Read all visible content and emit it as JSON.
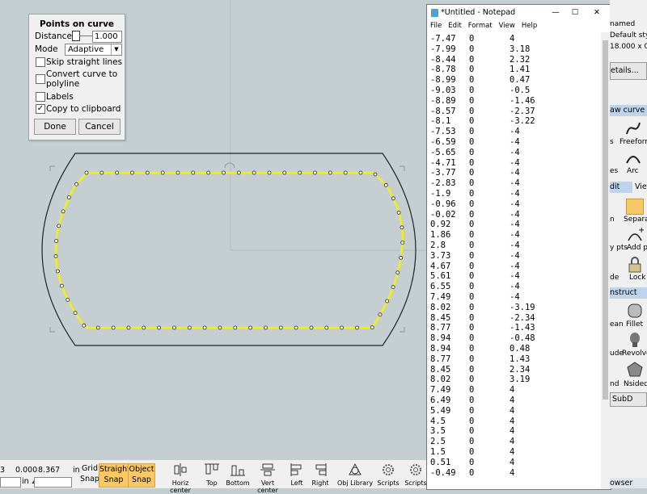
{
  "dialog": {
    "title": "Points on curve",
    "distance_label": "Distance",
    "distance_value": "1.000",
    "mode_label": "Mode",
    "mode_value": "Adaptive",
    "skip_label": "Skip straight lines",
    "convert_label_1": "Convert curve to",
    "convert_label_2": "polyline",
    "labels_label": "Labels",
    "copy_label": "Copy to clipboard",
    "done_label": "Done",
    "cancel_label": "Cancel",
    "skip_checked": false,
    "convert_checked": false,
    "labels_checked": false,
    "copy_checked": true
  },
  "notepad": {
    "title": "*Untitled - Notepad",
    "minimize": "—",
    "maximize": "☐",
    "close": "✕",
    "menu": [
      "File",
      "Edit",
      "Format",
      "View",
      "Help"
    ],
    "rows": [
      [
        "-7.47",
        "0",
        "4"
      ],
      [
        "-7.99",
        "0",
        "3.18"
      ],
      [
        "-8.44",
        "0",
        "2.32"
      ],
      [
        "-8.78",
        "0",
        "1.41"
      ],
      [
        "-8.99",
        "0",
        "0.47"
      ],
      [
        "-9.03",
        "0",
        "-0.5"
      ],
      [
        "-8.89",
        "0",
        "-1.46"
      ],
      [
        "-8.57",
        "0",
        "-2.37"
      ],
      [
        "-8.1",
        "0",
        "-3.22"
      ],
      [
        "-7.53",
        "0",
        "-4"
      ],
      [
        "-6.59",
        "0",
        "-4"
      ],
      [
        "-5.65",
        "0",
        "-4"
      ],
      [
        "-4.71",
        "0",
        "-4"
      ],
      [
        "-3.77",
        "0",
        "-4"
      ],
      [
        "-2.83",
        "0",
        "-4"
      ],
      [
        "-1.9",
        "0",
        "-4"
      ],
      [
        "-0.96",
        "0",
        "-4"
      ],
      [
        "-0.02",
        "0",
        "-4"
      ],
      [
        "0.92",
        "0",
        "-4"
      ],
      [
        "1.86",
        "0",
        "-4"
      ],
      [
        "2.8",
        "0",
        "-4"
      ],
      [
        "3.73",
        "0",
        "-4"
      ],
      [
        "4.67",
        "0",
        "-4"
      ],
      [
        "5.61",
        "0",
        "-4"
      ],
      [
        "6.55",
        "0",
        "-4"
      ],
      [
        "7.49",
        "0",
        "-4"
      ],
      [
        "8.02",
        "0",
        "-3.19"
      ],
      [
        "8.45",
        "0",
        "-2.34"
      ],
      [
        "8.77",
        "0",
        "-1.43"
      ],
      [
        "8.94",
        "0",
        "-0.48"
      ],
      [
        "8.94",
        "0",
        "0.48"
      ],
      [
        "8.77",
        "0",
        "1.43"
      ],
      [
        "8.45",
        "0",
        "2.34"
      ],
      [
        "8.02",
        "0",
        "3.19"
      ],
      [
        "7.49",
        "0",
        "4"
      ],
      [
        "6.49",
        "0",
        "4"
      ],
      [
        "5.49",
        "0",
        "4"
      ],
      [
        "4.5",
        "0",
        "4"
      ],
      [
        "3.5",
        "0",
        "4"
      ],
      [
        "2.5",
        "0",
        "4"
      ],
      [
        "1.5",
        "0",
        "4"
      ],
      [
        "0.51",
        "0",
        "4"
      ],
      [
        "-0.49",
        "0",
        "4"
      ]
    ]
  },
  "right_panel": {
    "doc_name": "named",
    "style": "Default sty",
    "size": "18.000 x 0",
    "details_button": "etails...",
    "draw_curve_tab": "aw curve",
    "freeform_label": "Freeform",
    "arc_label": "Arc",
    "s_label": "s",
    "es_label": "es",
    "edit_tab": "dit",
    "view_tab": "View",
    "separate_label": "Separat",
    "n_label": "n",
    "add_pts_label": "Add pt",
    "y_pts_label": "y pts",
    "lock_label": "Lock",
    "de_label": "de",
    "construct_tab": "nstruct",
    "fillet_label": "Fillet",
    "ean_label": "ean",
    "revolve_label": "Revolve",
    "ude_label": "ude",
    "nsided_label": "Nsided",
    "nd_label": "nd",
    "subd_button": "SubD",
    "browser_label": "owser"
  },
  "bottom": {
    "coord_prefix": "3",
    "coord_y": "0.000",
    "coord_z": "8.367",
    "unit": "in",
    "unit2": "in ∠",
    "grid_snap": [
      "Grid",
      "Snap"
    ],
    "straight_snap": [
      "Straight",
      "Snap"
    ],
    "object_snap": [
      "Object",
      "Snap"
    ],
    "tools": [
      "Horiz center",
      "Top",
      "Bottom",
      "Vert center",
      "Left",
      "Right",
      "Obj Library",
      "Scripts",
      "Scripts"
    ]
  },
  "colors": {
    "viewport": "#c5cfd2",
    "curve": "#f2ee1a",
    "snap_on": "#fbc866",
    "tab_highlight": "#bcd4ec"
  }
}
